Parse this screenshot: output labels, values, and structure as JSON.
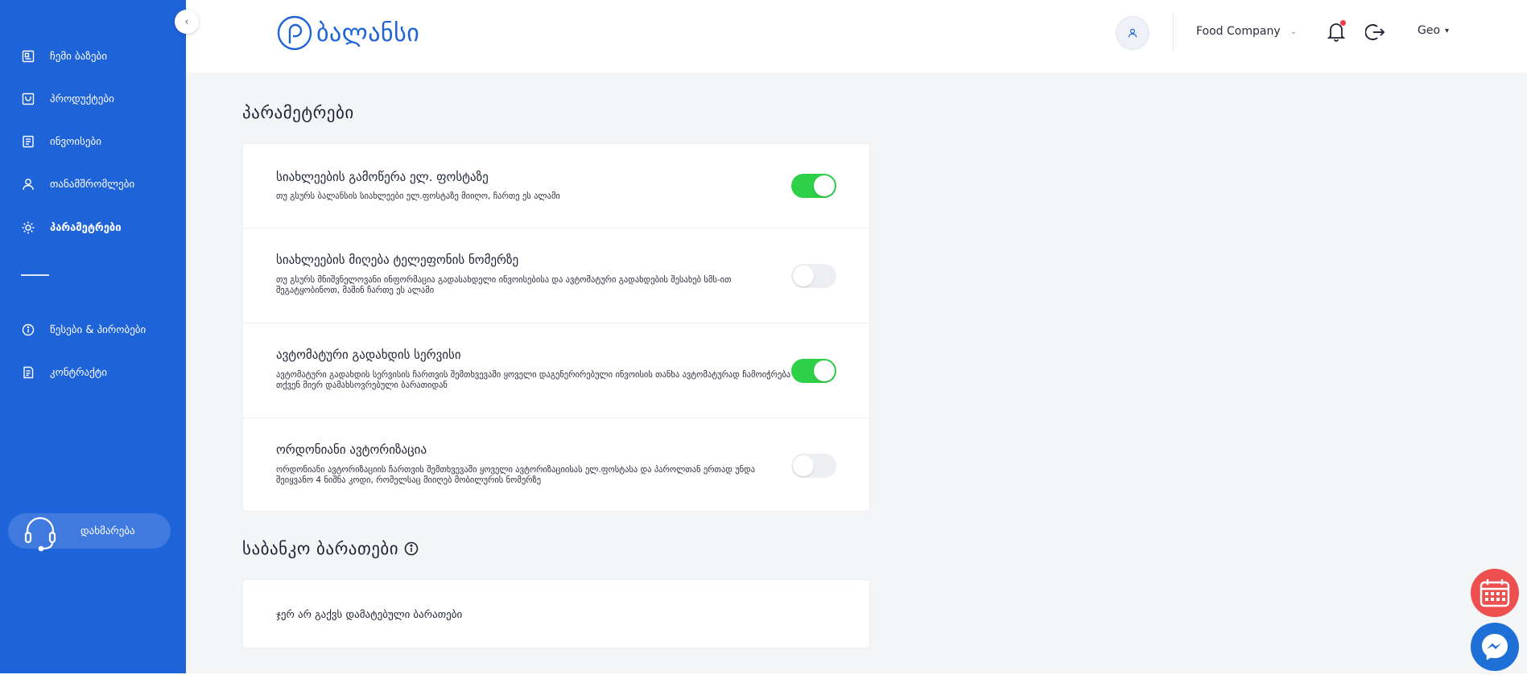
{
  "brand": {
    "logo_text": "ბალანსი",
    "accent": "#1f63d9"
  },
  "sidebar": {
    "items": [
      {
        "label": "ჩემი ბაზები",
        "icon": "database-icon",
        "active": false
      },
      {
        "label": "პროდუქტები",
        "icon": "product-icon",
        "active": false
      },
      {
        "label": "ინვოისები",
        "icon": "invoice-icon",
        "active": false
      },
      {
        "label": "თანამშრომლები",
        "icon": "user-icon",
        "active": false
      },
      {
        "label": "პარამეტრები",
        "icon": "gear-icon",
        "active": true
      }
    ],
    "secondary": [
      {
        "label": "წესები & პირობები",
        "icon": "info-icon"
      },
      {
        "label": "კონტრაქტი",
        "icon": "contract-icon"
      }
    ],
    "help_label": "დახმარება"
  },
  "header": {
    "company": "Food Company",
    "language": "Geo"
  },
  "settings": {
    "title": "პარამეტრები",
    "rows": [
      {
        "title": "სიახლეების გამოწერა ელ. ფოსტაზე",
        "desc": "თუ გსურს ბალანსის სიახლეები ელ.ფოსტაზე მიიღო, ჩართე ეს ალამი",
        "enabled": true
      },
      {
        "title": "სიახლეების მიღება ტელეფონის ნომერზე",
        "desc": "თუ გსურს მნიშვნელოვანი ინფორმაცია გადასახდელი ინვოისებისა და ავტომატური გადახდების შესახებ სმს-ით შეგატყობინოთ, მაშინ ჩართე ეს ალამი",
        "enabled": false
      },
      {
        "title": "ავტომატური გადახდის სერვისი",
        "desc": "ავტომატური გადახდის სერვისის ჩართვის შემთხვევაში ყოველი დაგენერირებული ინვოისის თანხა ავტომატურად ჩამოიჭრება თქვენ მიერ დამახსოვრებული ბარათიდან",
        "enabled": true
      },
      {
        "title": "ორდონიანი ავტორიზაცია",
        "desc": "ორდონიანი ავტორიზაციის ჩართვის შემთხვევაში ყოველი ავტორიზაციისას ელ.ფოსტასა და პაროლთან ერთად უნდა შეიყვანო 4 ნიშნა კოდი, რომელსაც მიიღებ მობილურის ნომერზე",
        "enabled": false
      }
    ]
  },
  "cards": {
    "title": "საბანკო ბარათები",
    "empty_text": "ჯერ არ გაქვს დამატებული ბარათები"
  },
  "colors": {
    "toggle_on": "#2ed048",
    "toggle_off": "#eceef2",
    "calendar_fab": "#ee4f4f",
    "messenger_fab": "#1e6fd6",
    "notification_dot": "#ef3b4c"
  }
}
